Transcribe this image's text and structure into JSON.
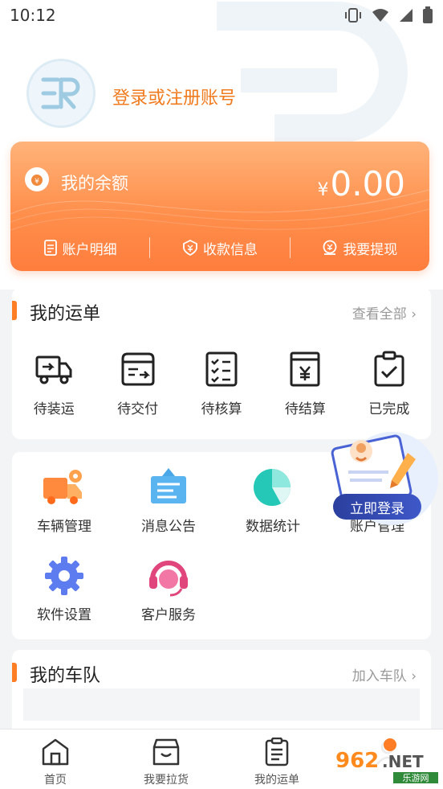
{
  "status_bar": {
    "time": "10:12"
  },
  "profile": {
    "login_text": "登录或注册账号"
  },
  "balance": {
    "title": "我的余额",
    "currency": "¥",
    "amount": "0.00",
    "actions": [
      {
        "label": "账户明细",
        "icon": "receipt-icon"
      },
      {
        "label": "收款信息",
        "icon": "yen-shield-icon"
      },
      {
        "label": "我要提现",
        "icon": "withdraw-icon"
      }
    ]
  },
  "orders": {
    "title": "我的运单",
    "view_all": "查看全部",
    "items": [
      {
        "label": "待装运",
        "icon": "truck-icon"
      },
      {
        "label": "待交付",
        "icon": "delivery-box-icon"
      },
      {
        "label": "待核算",
        "icon": "checklist-icon"
      },
      {
        "label": "待结算",
        "icon": "yen-document-icon"
      },
      {
        "label": "已完成",
        "icon": "clipboard-check-icon"
      }
    ]
  },
  "services": {
    "items": [
      {
        "label": "车辆管理",
        "icon": "vehicle-gear-icon"
      },
      {
        "label": "消息公告",
        "icon": "notice-board-icon"
      },
      {
        "label": "数据统计",
        "icon": "pie-chart-icon"
      },
      {
        "label": "账户管理",
        "icon": "account-icon"
      },
      {
        "label": "软件设置",
        "icon": "settings-gear-icon"
      },
      {
        "label": "客户服务",
        "icon": "headset-icon"
      }
    ]
  },
  "float_login": {
    "label": "立即登录"
  },
  "fleet": {
    "title": "我的车队",
    "join": "加入车队"
  },
  "tabbar": {
    "items": [
      {
        "label": "首页",
        "icon": "home-icon"
      },
      {
        "label": "我要拉货",
        "icon": "cargo-box-icon"
      },
      {
        "label": "我的运单",
        "icon": "waybill-icon"
      }
    ]
  },
  "watermark_logo": {
    "text": "962.NET",
    "subtext": "乐游网"
  },
  "colors": {
    "accent": "#ff7d24",
    "login": "#f07b1e",
    "button": "#3f58c8"
  }
}
